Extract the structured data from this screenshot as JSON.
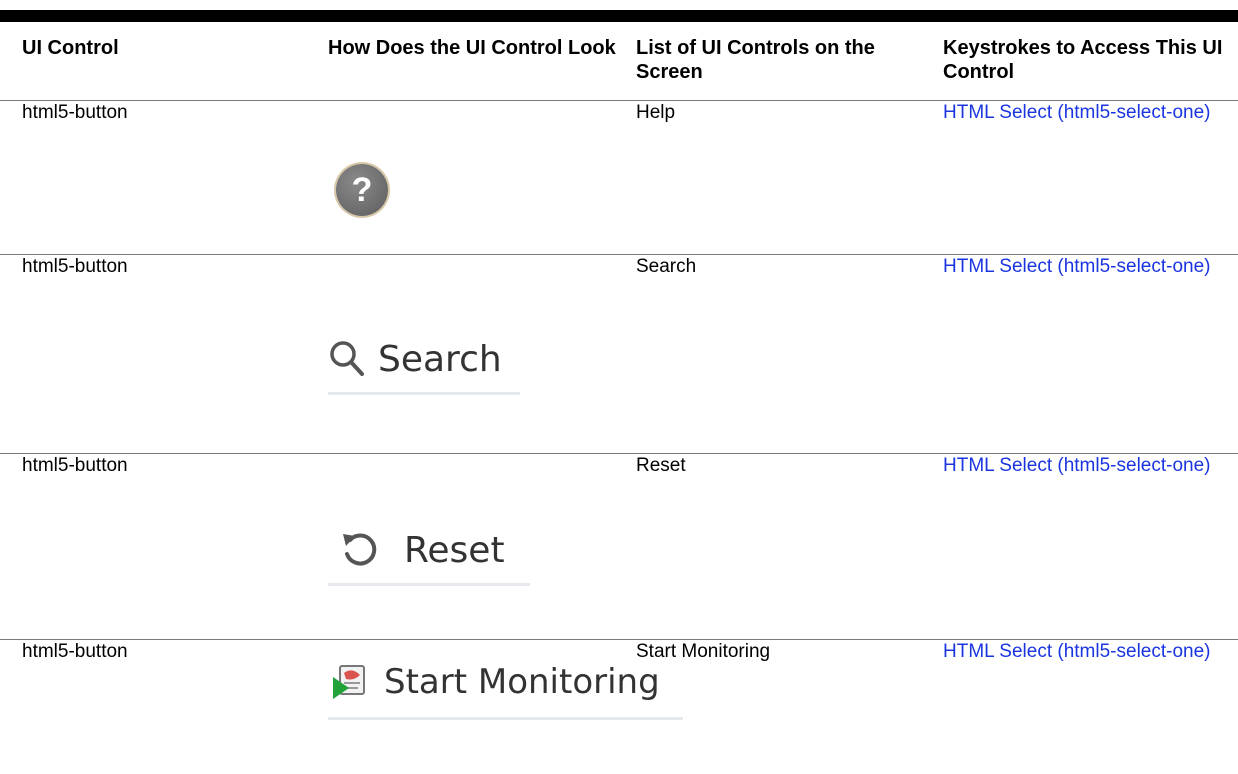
{
  "header": {
    "col1": "UI Control",
    "col2": "How Does the UI Control Look",
    "col3": "List of UI Controls on the Screen",
    "col4": "Keystrokes to Access This UI Control"
  },
  "rows": [
    {
      "control": "html5-button",
      "preview_icon": "help-question-icon",
      "preview_label": "",
      "list_item": "Help",
      "keystroke_link": "HTML Select (html5-select-one)"
    },
    {
      "control": "html5-button",
      "preview_icon": "search-icon",
      "preview_label": "Search",
      "list_item": "Search",
      "keystroke_link": "HTML Select (html5-select-one)"
    },
    {
      "control": "html5-button",
      "preview_icon": "reset-icon",
      "preview_label": "Reset",
      "list_item": "Reset",
      "keystroke_link": "HTML Select (html5-select-one)"
    },
    {
      "control": "html5-button",
      "preview_icon": "start-monitoring-icon",
      "preview_label": "Start Monitoring",
      "list_item": "Start Monitoring",
      "keystroke_link": "HTML Select (html5-select-one)"
    }
  ],
  "colors": {
    "link": "#1a35e0",
    "rule": "#000000",
    "separator": "#7a7a7a"
  }
}
